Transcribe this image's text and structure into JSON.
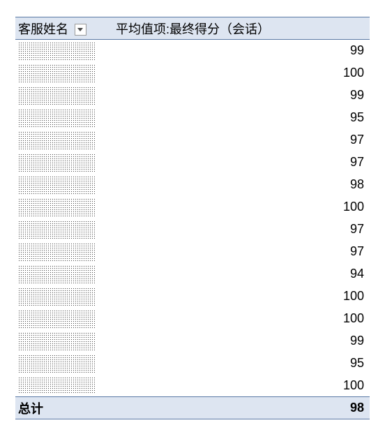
{
  "header": {
    "col_name": "客服姓名",
    "col_value": "平均值项:最终得分（会话）"
  },
  "rows": [
    {
      "value": 99
    },
    {
      "value": 100
    },
    {
      "value": 99
    },
    {
      "value": 95
    },
    {
      "value": 97
    },
    {
      "value": 97
    },
    {
      "value": 98
    },
    {
      "value": 100
    },
    {
      "value": 97
    },
    {
      "value": 97
    },
    {
      "value": 94
    },
    {
      "value": 100
    },
    {
      "value": 100
    },
    {
      "value": 99
    },
    {
      "value": 95
    },
    {
      "value": 100
    }
  ],
  "total": {
    "label": "总计",
    "value": 98
  },
  "chart_data": {
    "type": "table",
    "title": "平均值项:最终得分（会话）",
    "columns": [
      "客服姓名",
      "平均值项:最终得分（会话）"
    ],
    "values": [
      99,
      100,
      99,
      95,
      97,
      97,
      98,
      100,
      97,
      97,
      94,
      100,
      100,
      99,
      95,
      100
    ],
    "total": 98
  }
}
